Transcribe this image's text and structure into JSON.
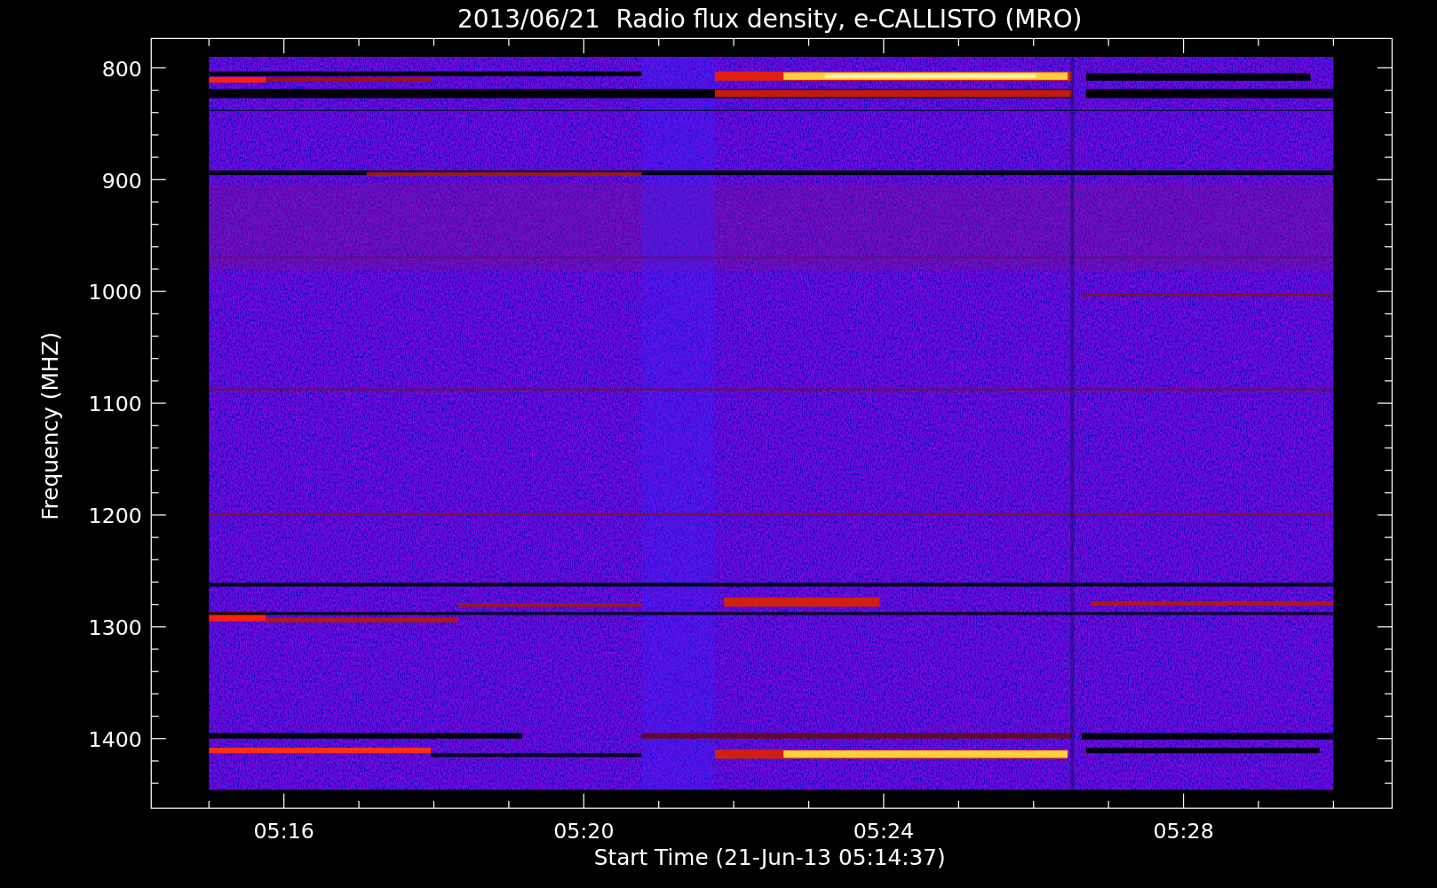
{
  "title": "2013/06/21  Radio flux density, e-CALLISTO (MRO)",
  "y_axis": {
    "label": "Frequency (MHZ)",
    "ticks": [
      "800",
      "900",
      "1000",
      "1100",
      "1200",
      "1300",
      "1400"
    ]
  },
  "x_axis": {
    "label": "Start Time (21-Jun-13 05:14:37)",
    "ticks": [
      "05:16",
      "05:20",
      "05:24",
      "05:28"
    ]
  }
}
